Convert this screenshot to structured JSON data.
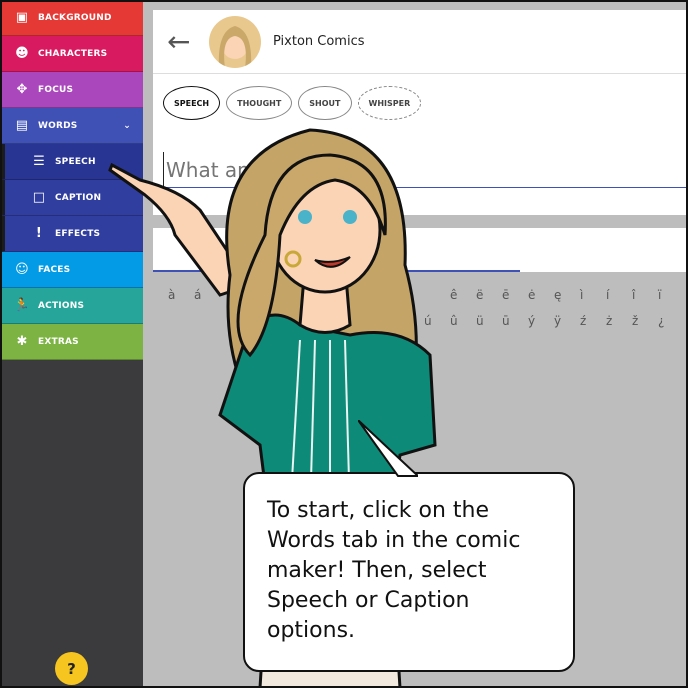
{
  "sidebar": {
    "items": [
      {
        "label": "BACKGROUND",
        "icon": "image-icon",
        "color": "#e53935"
      },
      {
        "label": "CHARACTERS",
        "icon": "face-outline-icon",
        "color": "#d81b60"
      },
      {
        "label": "FOCUS",
        "icon": "move-icon",
        "color": "#ab47bc"
      },
      {
        "label": "WORDS",
        "icon": "chat-icon",
        "color": "#3f51b5"
      },
      {
        "label": "SPEECH",
        "icon": "list-icon",
        "color": "#283593"
      },
      {
        "label": "CAPTION",
        "icon": "caption-icon",
        "color": "#303f9f"
      },
      {
        "label": "EFFECTS",
        "icon": "exclamation-icon",
        "color": "#303f9f"
      },
      {
        "label": "FACES",
        "icon": "smiley-icon",
        "color": "#039be5"
      },
      {
        "label": "ACTIONS",
        "icon": "running-icon",
        "color": "#26a69a"
      },
      {
        "label": "EXTRAS",
        "icon": "puzzle-icon",
        "color": "#7cb342"
      }
    ],
    "help": "?"
  },
  "header": {
    "title": "Pixton Comics"
  },
  "bubbles": [
    "SPEECH",
    "THOUGHT",
    "SHOUT",
    "WHISPER"
  ],
  "input": {
    "placeholder": "What am I sa"
  },
  "accents": {
    "row1a": [
      "à",
      "á"
    ],
    "row1b": [
      "ê",
      "ë",
      "ē",
      "ė",
      "ę",
      "ì",
      "í",
      "î",
      "ï"
    ],
    "row2": [
      "ú",
      "û",
      "ü",
      "ū",
      "ý",
      "ÿ",
      "ź",
      "ż",
      "ž",
      "¿"
    ]
  },
  "callout": "To start, click on the Words tab in the comic maker! Then, select Speech or Caption options."
}
